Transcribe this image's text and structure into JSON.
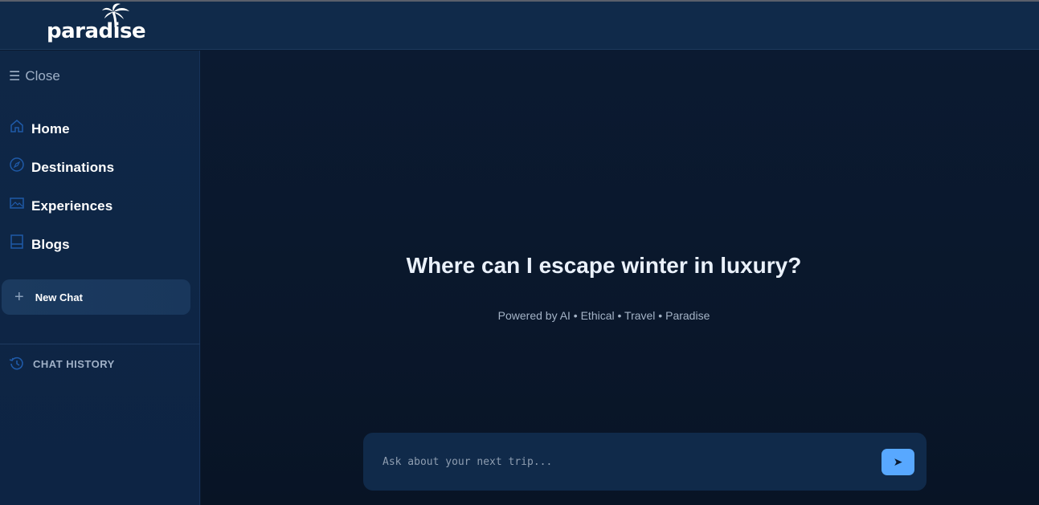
{
  "brand": {
    "logo_text": "paradise"
  },
  "sidebar": {
    "close_label": "Close",
    "close_glyph": "☰",
    "nav": [
      {
        "label": "Home",
        "icon": "home-icon"
      },
      {
        "label": "Destinations",
        "icon": "compass-icon"
      },
      {
        "label": "Experiences",
        "icon": "image-icon"
      },
      {
        "label": "Blogs",
        "icon": "book-icon"
      }
    ],
    "new_chat_label": "New Chat",
    "new_chat_glyph": "+",
    "history_label": "CHAT HISTORY"
  },
  "main": {
    "headline": "Where can I escape winter in luxury?",
    "tagline": "Powered by AI • Ethical • Travel • Paradise",
    "input_placeholder": "Ask about your next trip...",
    "send_glyph": "➤"
  },
  "colors": {
    "accent": "#58a8ff",
    "header_bg": "#102a4a",
    "icon_blue": "#1f5aa8"
  }
}
